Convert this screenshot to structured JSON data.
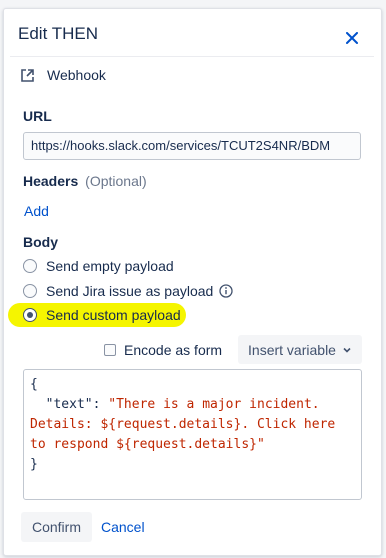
{
  "dialog": {
    "title": "Edit THEN",
    "close_icon": "close-icon",
    "action_type": "Webhook",
    "action_icon": "external-link-icon"
  },
  "url": {
    "label": "URL",
    "value": "https://hooks.slack.com/services/TCUT2S4NR/BDM"
  },
  "headers": {
    "label": "Headers",
    "optional": "(Optional)",
    "add_label": "Add"
  },
  "body": {
    "label": "Body",
    "options": [
      {
        "label": "Send empty payload",
        "checked": false
      },
      {
        "label": "Send Jira issue as payload",
        "checked": false,
        "icon": "info-icon"
      },
      {
        "label": "Send custom payload",
        "checked": true
      }
    ],
    "highlight_color": "#f5f500",
    "encode_label": "Encode as form",
    "encode_checked": false,
    "insert_variable_label": "Insert variable",
    "payload": {
      "line1": "{",
      "key": "\"text\"",
      "colon": ": ",
      "value_line1": "\"There is a major incident.",
      "value_line2": "Details: ${request.details}. Click here",
      "value_line3": "to respond ${request.details}\"",
      "line_last": "}"
    }
  },
  "footer": {
    "confirm_label": "Confirm",
    "cancel_label": "Cancel"
  },
  "colors": {
    "link": "#0052cc",
    "string": "#bf2600"
  }
}
